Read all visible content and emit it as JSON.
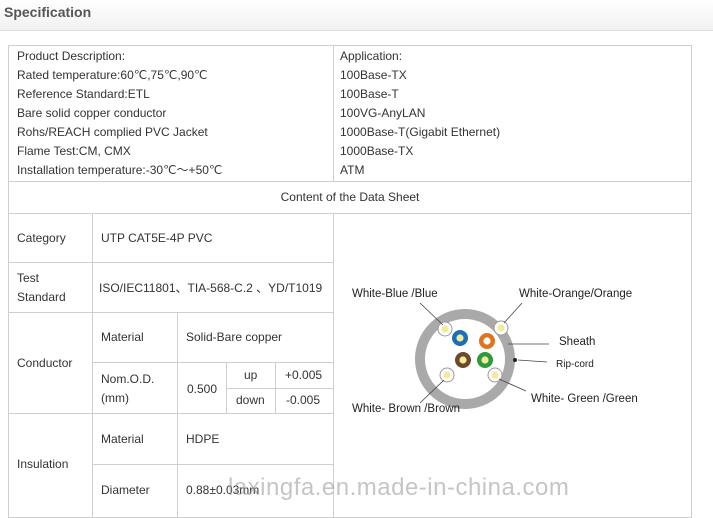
{
  "header": {
    "title": "Specification"
  },
  "description": {
    "lines": [
      "Product Description:",
      "Rated temperature:60℃,75℃,90℃",
      "Reference Standard:ETL",
      "Bare solid copper conductor",
      "Rohs/REACH complied PVC Jacket",
      "Flame Test:CM, CMX",
      "Installation temperature:-30℃～+50℃"
    ]
  },
  "application": {
    "lines": [
      "Application:",
      "100Base-TX",
      "100Base-T",
      "100VG-AnyLAN",
      "1000Base-T(Gigabit Ethernet)",
      "1000Base-TX",
      "ATM"
    ]
  },
  "datasheet": {
    "title": "Content of the Data Sheet",
    "category": {
      "label": "Category",
      "value": "UTP CAT5E-4P PVC"
    },
    "test_standard": {
      "label_line1": "Test",
      "label_line2": "Standard",
      "value": "ISO/IEC11801、TIA-568-C.2 、YD/T1019"
    },
    "conductor": {
      "label": "Conductor",
      "material_label": "Material",
      "material_value": "Solid-Bare copper",
      "od_label_line1": "Nom.O.D.",
      "od_label_line2": "(mm)",
      "od_value": "0.500",
      "up_label": "up",
      "up_value": "+0.005",
      "down_label": "down",
      "down_value": "-0.005"
    },
    "insulation": {
      "label": "Insulation",
      "material_label": "Material",
      "material_value": "HDPE",
      "diameter_label": "Diameter",
      "diameter_value": "0.88±0.03mm"
    }
  },
  "diagram": {
    "labels": {
      "white_blue": "White-Blue /Blue",
      "white_orange": "White-Orange/Orange",
      "sheath": "Sheath",
      "ripcord": "Rip-cord",
      "white_brown": "White- Brown /Brown",
      "white_green": "White- Green /Green"
    },
    "colors": {
      "sheath": "#a9a9a9",
      "blue": "#1e6fb5",
      "orange": "#e0731f",
      "brown": "#6b4a2b",
      "green": "#2f9a3a",
      "white_stripe": "#f2ea9c"
    }
  },
  "watermark": "laxingfa.en.made-in-china.com"
}
